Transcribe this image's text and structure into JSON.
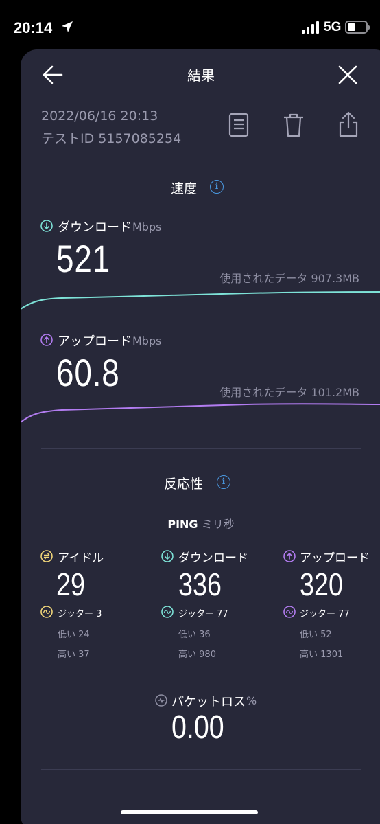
{
  "status_bar": {
    "time": "20:14",
    "network": "5G"
  },
  "header": {
    "title": "結果"
  },
  "meta": {
    "date": "2022/06/16 20:13",
    "test_id": "テストID 5157085254"
  },
  "speed": {
    "title": "速度",
    "download": {
      "label": "ダウンロード",
      "unit": "Mbps",
      "value": "521",
      "data_used": "使用されたデータ 907.3MB",
      "color": "#7ee3d8"
    },
    "upload": {
      "label": "アップロード",
      "unit": "Mbps",
      "value": "60.8",
      "data_used": "使用されたデータ 101.2MB",
      "color": "#b27cf0"
    }
  },
  "responsiveness": {
    "title": "反応性",
    "ping_label": "PING",
    "ping_unit": "ミリ秒",
    "idle": {
      "label": "アイドル",
      "value": "29",
      "jitter_label": "ジッター",
      "jitter": "3",
      "low_label": "低い",
      "low": "24",
      "high_label": "高い",
      "high": "37",
      "color": "#f2d77a"
    },
    "download": {
      "label": "ダウンロード",
      "value": "336",
      "jitter_label": "ジッター",
      "jitter": "77",
      "low_label": "低い",
      "low": "36",
      "high_label": "高い",
      "high": "980",
      "color": "#7ee3d8"
    },
    "upload": {
      "label": "アップロード",
      "value": "320",
      "jitter_label": "ジッター",
      "jitter": "77",
      "low_label": "低い",
      "low": "52",
      "high_label": "高い",
      "high": "1301",
      "color": "#b27cf0"
    },
    "packet_loss": {
      "label": "パケットロス",
      "unit": "%",
      "value": "0.00"
    }
  },
  "icons": {
    "accent_info": "#4a98e0"
  }
}
